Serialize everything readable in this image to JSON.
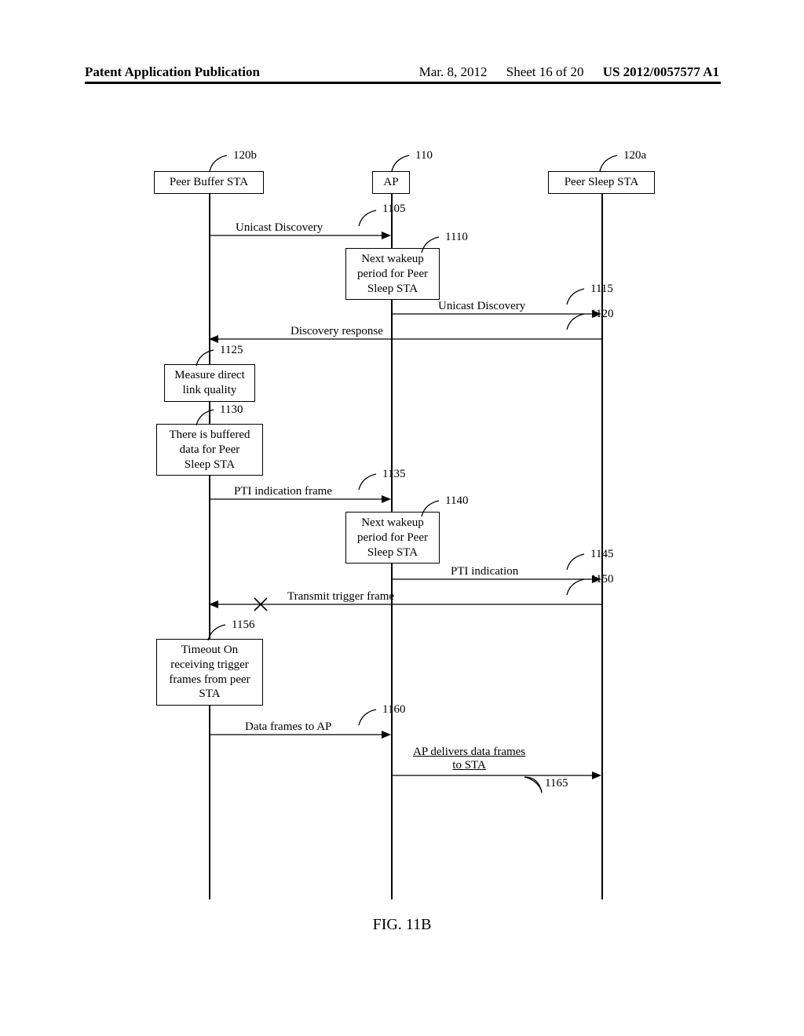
{
  "header": {
    "left": "Patent Application Publication",
    "date": "Mar. 8, 2012",
    "sheet": "Sheet 16 of 20",
    "pubnum": "US 2012/0057577 A1"
  },
  "actors": {
    "peer_buffer": {
      "label": "Peer Buffer STA",
      "ref": "120b"
    },
    "ap": {
      "label": "AP",
      "ref": "110"
    },
    "peer_sleep": {
      "label": "Peer Sleep STA",
      "ref": "120a"
    }
  },
  "messages": {
    "m1105": {
      "text": "Unicast Discovery",
      "ref": "1105"
    },
    "m1110": {
      "text": "Next wakeup\nperiod for Peer\nSleep STA",
      "ref": "1110"
    },
    "m1115": {
      "text": "Unicast Discovery",
      "ref": "1115"
    },
    "m1120": {
      "text": "Discovery response",
      "ref": "1120"
    },
    "m1125": {
      "text": "Measure direct\nlink quality",
      "ref": "1125"
    },
    "m1130": {
      "text": "There is buffered\ndata for Peer\nSleep STA",
      "ref": "1130"
    },
    "m1135": {
      "text": "PTI indication frame",
      "ref": "1135"
    },
    "m1140": {
      "text": "Next wakeup\nperiod for Peer\nSleep STA",
      "ref": "1140"
    },
    "m1145": {
      "text": "PTI indication",
      "ref": "1145"
    },
    "m1150": {
      "text": "Transmit trigger frame",
      "ref": "1150"
    },
    "m1156": {
      "text": "Timeout On\nreceiving trigger\nframes from peer\nSTA",
      "ref": "1156"
    },
    "m1160": {
      "text": "Data frames to AP",
      "ref": "1160"
    },
    "m1165": {
      "text": "AP delivers data frames\nto STA",
      "ref": "1165"
    }
  },
  "caption": "FIG. 11B"
}
